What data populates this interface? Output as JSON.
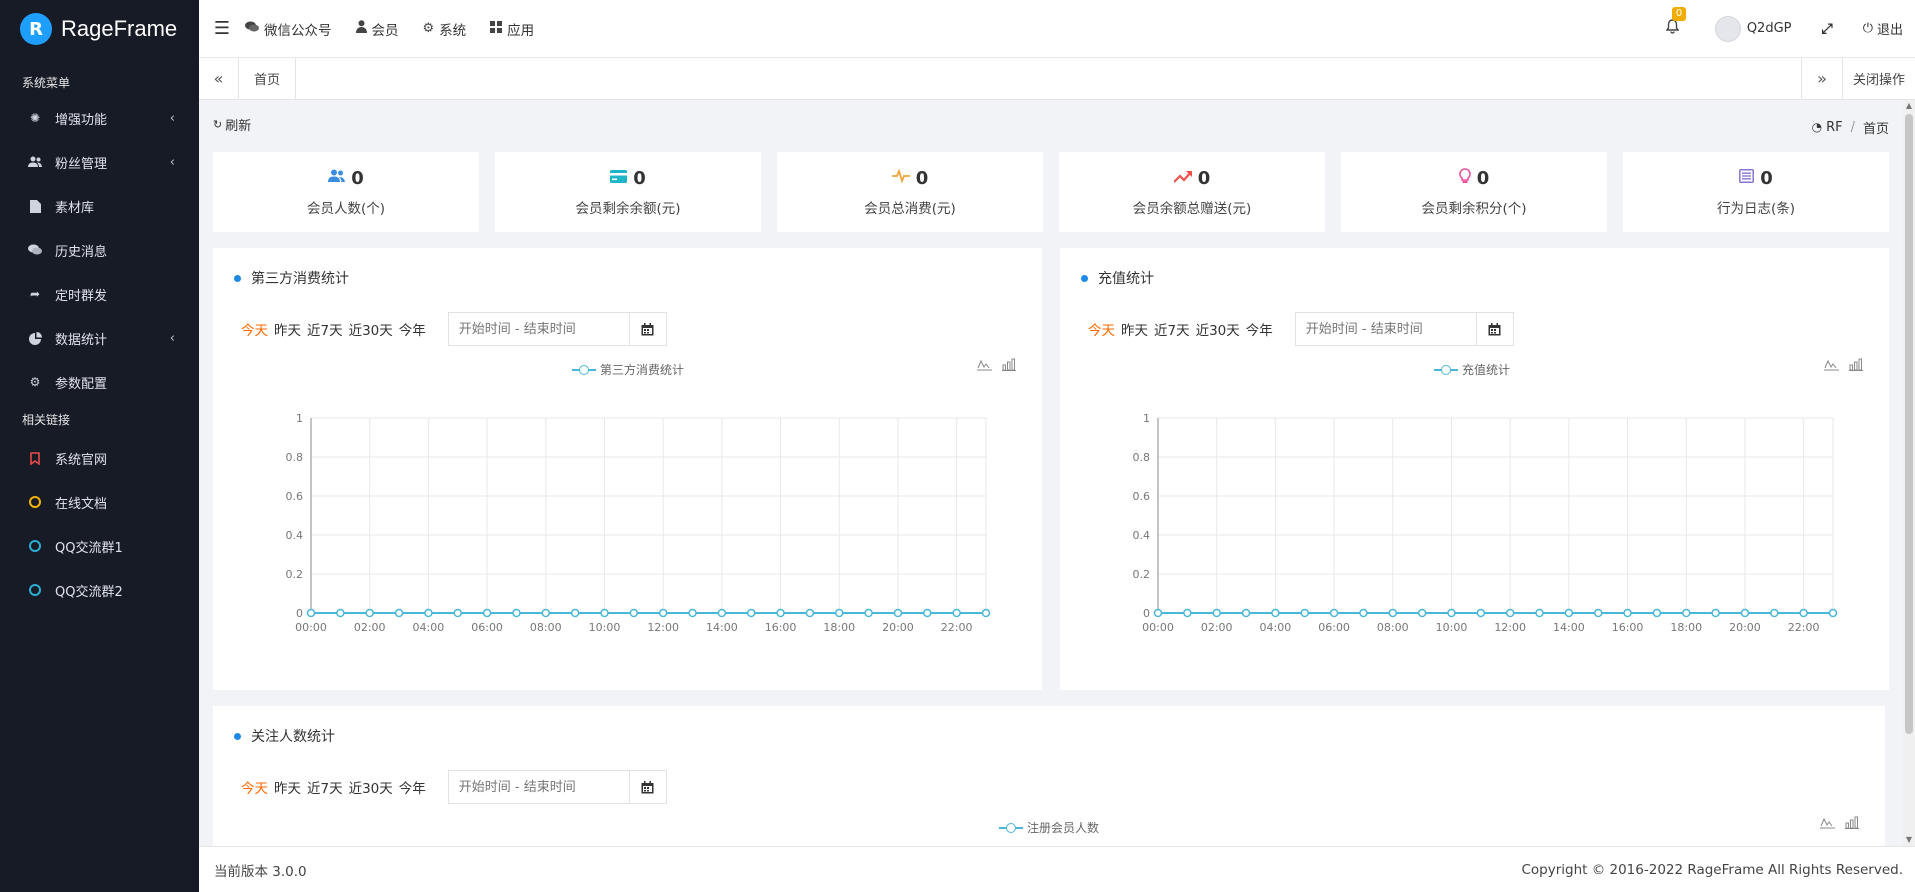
{
  "brand": {
    "name": "RageFrame",
    "logo_letter": "R"
  },
  "sidebar": {
    "section1": "系统菜单",
    "items": [
      {
        "label": "增强功能",
        "icon": "gear-icon",
        "caret": true
      },
      {
        "label": "粉丝管理",
        "icon": "users-icon",
        "caret": true
      },
      {
        "label": "素材库",
        "icon": "file-icon",
        "caret": false
      },
      {
        "label": "历史消息",
        "icon": "comments-icon",
        "caret": false
      },
      {
        "label": "定时群发",
        "icon": "share-icon",
        "caret": false
      },
      {
        "label": "数据统计",
        "icon": "pie-chart-icon",
        "caret": true
      },
      {
        "label": "参数配置",
        "icon": "cog-icon",
        "caret": false
      }
    ],
    "section2": "相关链接",
    "links": [
      {
        "label": "系统官网",
        "color": "#e84b4b"
      },
      {
        "label": "在线文档",
        "color": "#f3b300"
      },
      {
        "label": "QQ交流群1",
        "color": "#2aaed1"
      },
      {
        "label": "QQ交流群2",
        "color": "#2aaed1"
      }
    ]
  },
  "topnav": {
    "items": [
      {
        "label": "微信公众号",
        "icon": "comments-icon"
      },
      {
        "label": "会员",
        "icon": "user-icon"
      },
      {
        "label": "系统",
        "icon": "cogs-icon"
      },
      {
        "label": "应用",
        "icon": "grid-icon"
      }
    ],
    "notifications": "0",
    "username": "Q2dGP",
    "logout": "退出"
  },
  "tabs": {
    "home": "首页",
    "close_ops": "关闭操作"
  },
  "toolbar": {
    "refresh": "刷新"
  },
  "breadcrumb": {
    "root": "RF",
    "current": "首页"
  },
  "stats": [
    {
      "value": "0",
      "label": "会员人数(个)",
      "icon": "users-icon",
      "color": "#3b8de0"
    },
    {
      "value": "0",
      "label": "会员剩余余额(元)",
      "icon": "credit-card-icon",
      "color": "#1fb5c9"
    },
    {
      "value": "0",
      "label": "会员总消费(元)",
      "icon": "heartbeat-icon",
      "color": "#f0a53a"
    },
    {
      "value": "0",
      "label": "会员余额总赠送(元)",
      "icon": "trend-up-icon",
      "color": "#f0504a"
    },
    {
      "value": "0",
      "label": "会员剩余积分(个)",
      "icon": "lightbulb-icon",
      "color": "#ee4d9a"
    },
    {
      "value": "0",
      "label": "行为日志(条)",
      "icon": "list-icon",
      "color": "#8c74d6"
    }
  ],
  "filters": [
    "今天",
    "昨天",
    "近7天",
    "近30天",
    "今年"
  ],
  "date_placeholder": "开始时间 - 结束时间",
  "panels": {
    "third_party": {
      "title": "第三方消费统计",
      "legend": "第三方消费统计"
    },
    "recharge": {
      "title": "充值统计",
      "legend": "充值统计"
    },
    "follow": {
      "title": "关注人数统计",
      "legend": "注册会员人数"
    }
  },
  "chart_data": [
    {
      "type": "line",
      "x": [
        "00:00",
        "01:00",
        "02:00",
        "03:00",
        "04:00",
        "05:00",
        "06:00",
        "07:00",
        "08:00",
        "09:00",
        "10:00",
        "11:00",
        "12:00",
        "13:00",
        "14:00",
        "15:00",
        "16:00",
        "17:00",
        "18:00",
        "19:00",
        "20:00",
        "21:00",
        "22:00",
        "23:00"
      ],
      "series": [
        {
          "name": "第三方消费统计",
          "values": [
            0,
            0,
            0,
            0,
            0,
            0,
            0,
            0,
            0,
            0,
            0,
            0,
            0,
            0,
            0,
            0,
            0,
            0,
            0,
            0,
            0,
            0,
            0,
            0
          ]
        }
      ],
      "x_tick_labels": [
        "00:00",
        "02:00",
        "04:00",
        "06:00",
        "08:00",
        "10:00",
        "12:00",
        "14:00",
        "16:00",
        "18:00",
        "20:00",
        "22:00"
      ],
      "y_ticks": [
        "0",
        "0.2",
        "0.4",
        "0.6",
        "0.8",
        "1"
      ],
      "ylim": [
        0,
        1
      ],
      "grid": true,
      "legend": "top-center"
    },
    {
      "type": "line",
      "x": [
        "00:00",
        "01:00",
        "02:00",
        "03:00",
        "04:00",
        "05:00",
        "06:00",
        "07:00",
        "08:00",
        "09:00",
        "10:00",
        "11:00",
        "12:00",
        "13:00",
        "14:00",
        "15:00",
        "16:00",
        "17:00",
        "18:00",
        "19:00",
        "20:00",
        "21:00",
        "22:00",
        "23:00"
      ],
      "series": [
        {
          "name": "充值统计",
          "values": [
            0,
            0,
            0,
            0,
            0,
            0,
            0,
            0,
            0,
            0,
            0,
            0,
            0,
            0,
            0,
            0,
            0,
            0,
            0,
            0,
            0,
            0,
            0,
            0
          ]
        }
      ],
      "x_tick_labels": [
        "00:00",
        "02:00",
        "04:00",
        "06:00",
        "08:00",
        "10:00",
        "12:00",
        "14:00",
        "16:00",
        "18:00",
        "20:00",
        "22:00"
      ],
      "y_ticks": [
        "0",
        "0.2",
        "0.4",
        "0.6",
        "0.8",
        "1"
      ],
      "ylim": [
        0,
        1
      ],
      "grid": true,
      "legend": "top-center"
    }
  ],
  "footer": {
    "version": "当前版本 3.0.0",
    "copyright": "Copyright © 2016-2022 RageFrame All Rights Reserved."
  },
  "colors": {
    "accent": "#1e88e5",
    "line": "#4ab6d8",
    "active_filter": "#ff6a00",
    "sidebar_bg": "#171b26"
  }
}
